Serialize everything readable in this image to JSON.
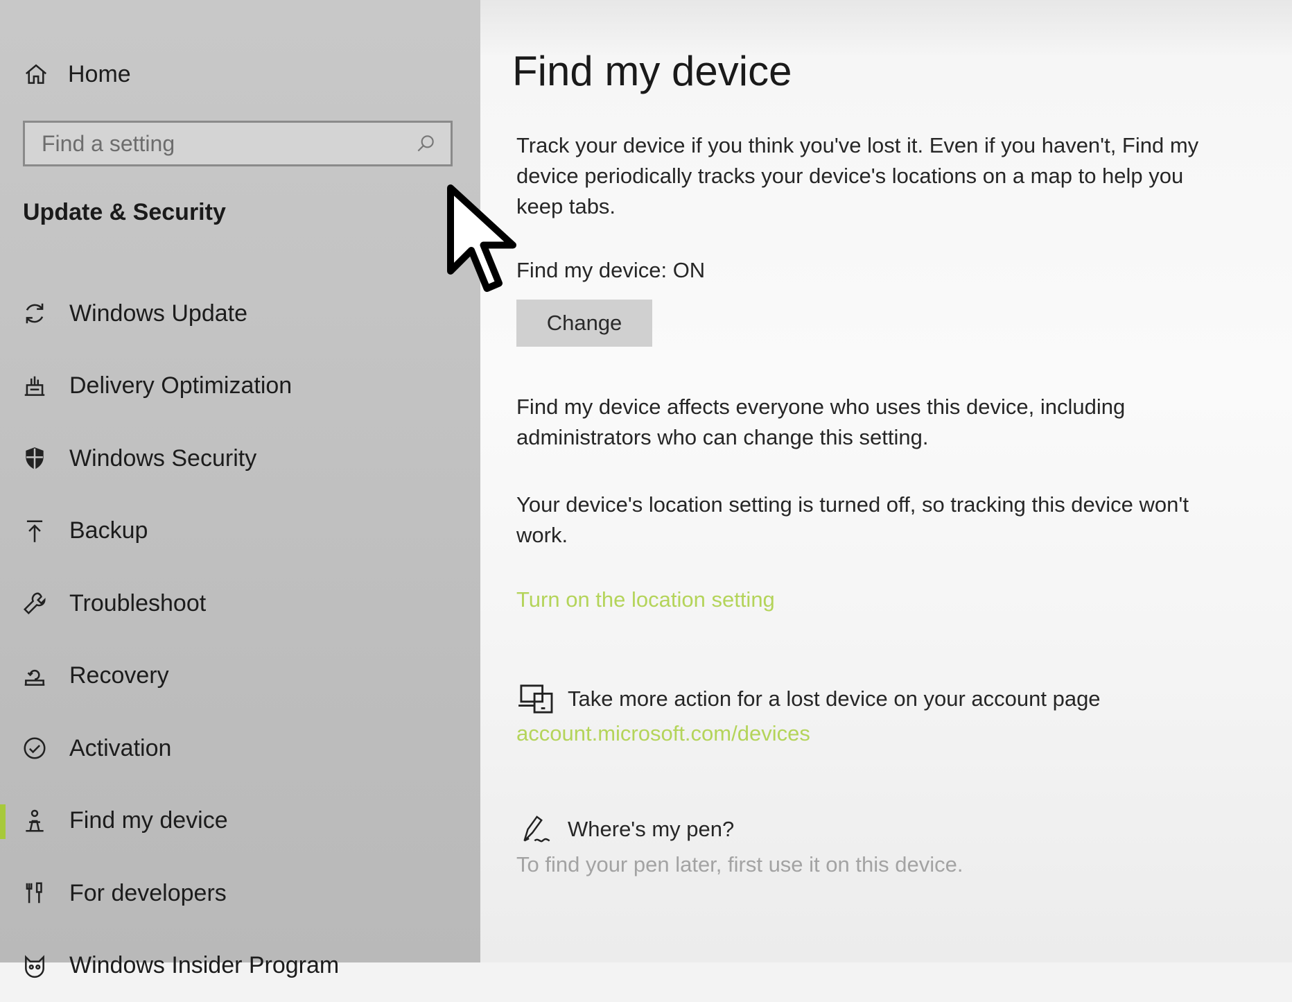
{
  "sidebar": {
    "home": {
      "label": "Home",
      "icon": "home-icon"
    },
    "search": {
      "placeholder": "Find a setting",
      "icon": "search-icon"
    },
    "section_title": "Update & Security",
    "items": [
      {
        "label": "Windows Update",
        "icon": "sync-icon"
      },
      {
        "label": "Delivery Optimization",
        "icon": "delivery-optimization-icon"
      },
      {
        "label": "Windows Security",
        "icon": "shield-icon"
      },
      {
        "label": "Backup",
        "icon": "backup-arrow-icon"
      },
      {
        "label": "Troubleshoot",
        "icon": "wrench-icon"
      },
      {
        "label": "Recovery",
        "icon": "recovery-icon"
      },
      {
        "label": "Activation",
        "icon": "check-circle-icon"
      },
      {
        "label": "Find my device",
        "icon": "find-person-icon",
        "selected": true
      },
      {
        "label": "For developers",
        "icon": "developer-tools-icon"
      },
      {
        "label": "Windows Insider Program",
        "icon": "insider-cat-icon"
      }
    ],
    "accent_color": "#a7c93b"
  },
  "main": {
    "title": "Find my device",
    "intro": "Track your device if you think you've lost it. Even if you haven't, Find my device periodically tracks your device's locations on a map to help you keep tabs.",
    "status": "Find my device: ON",
    "change_button": "Change",
    "affects_text": "Find my device affects everyone who uses this device, including administrators who can change this setting.",
    "location_text": "Your device's location setting is turned off, so tracking this device won't work.",
    "location_link": "Turn on the location setting",
    "account_text": "Take more action for a lost device on your account page",
    "account_link": "account.microsoft.com/devices",
    "pen_title": "Where's my pen?",
    "pen_subtext": "To find your pen later, first use it on this device.",
    "link_color": "#b4d45a"
  }
}
